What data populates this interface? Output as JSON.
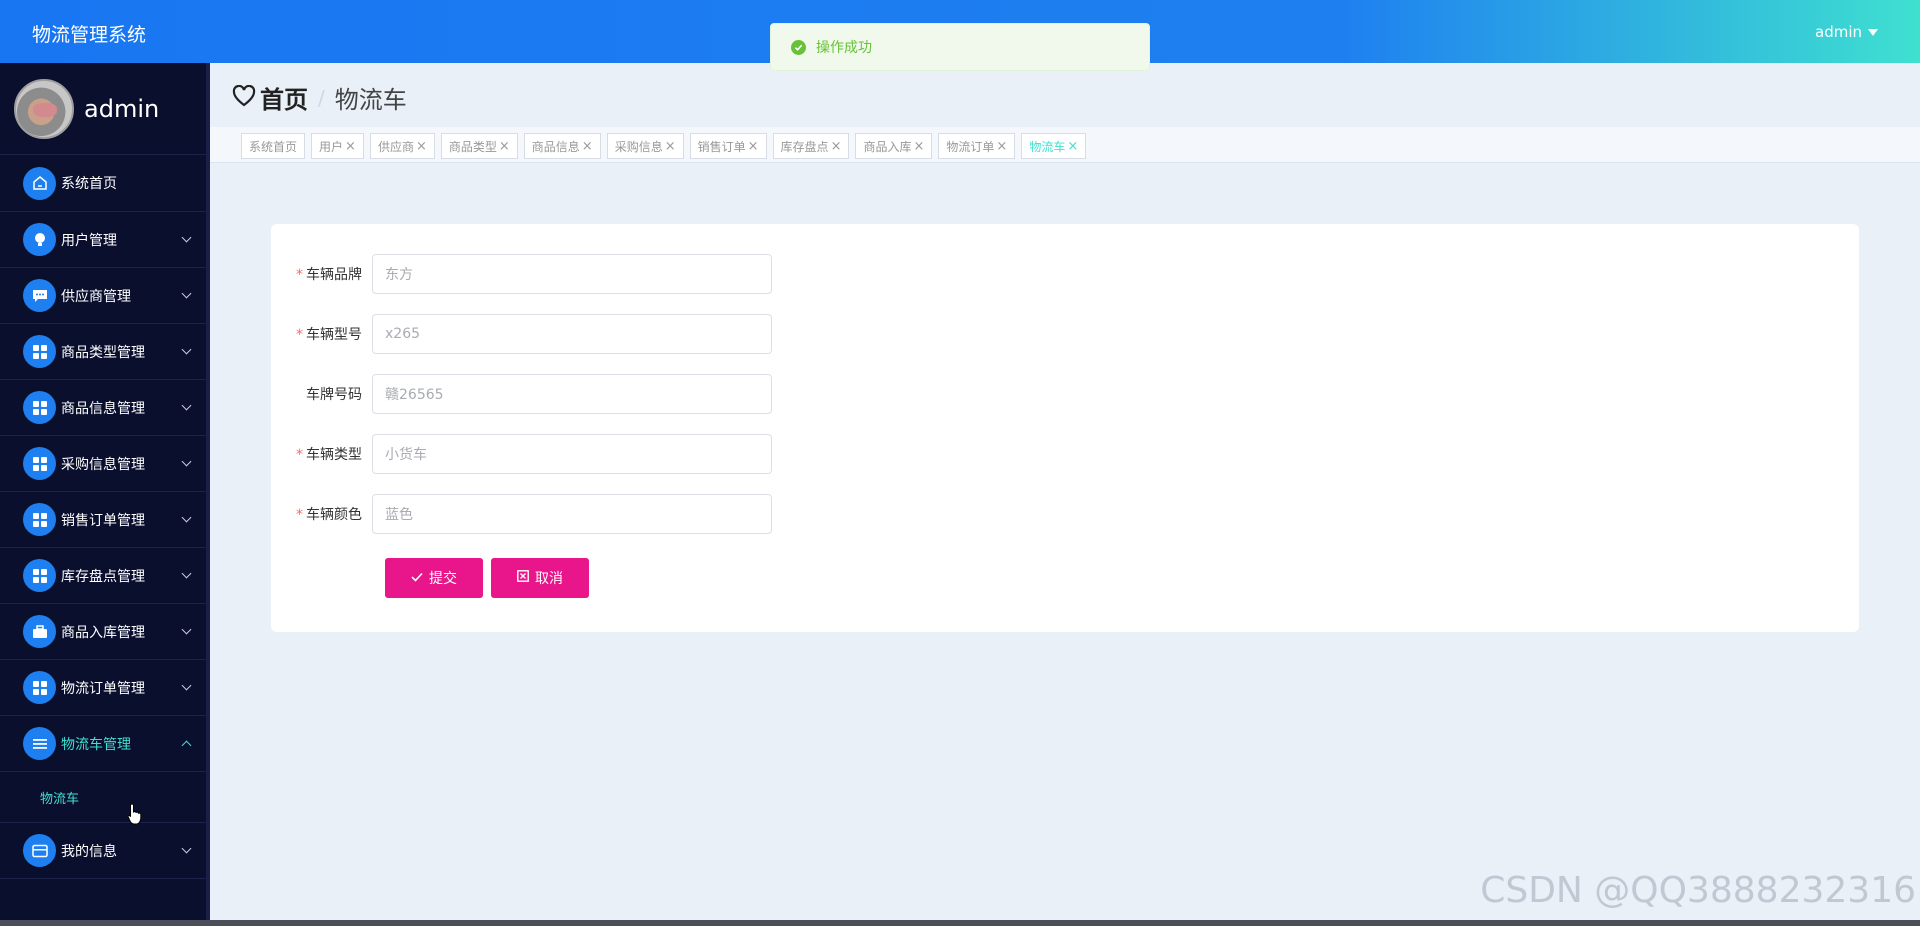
{
  "header": {
    "title": "物流管理系统",
    "user": "admin"
  },
  "toast": {
    "message": "操作成功"
  },
  "sidebar": {
    "username": "admin",
    "items": [
      {
        "label": "系统首页",
        "icon": "home-icon"
      },
      {
        "label": "用户管理",
        "icon": "bulb-icon"
      },
      {
        "label": "供应商管理",
        "icon": "chat-icon"
      },
      {
        "label": "商品类型管理",
        "icon": "grid-icon"
      },
      {
        "label": "商品信息管理",
        "icon": "grid-icon"
      },
      {
        "label": "采购信息管理",
        "icon": "grid-icon"
      },
      {
        "label": "销售订单管理",
        "icon": "grid-icon"
      },
      {
        "label": "库存盘点管理",
        "icon": "grid-icon"
      },
      {
        "label": "商品入库管理",
        "icon": "briefcase-icon"
      },
      {
        "label": "物流订单管理",
        "icon": "grid-icon"
      },
      {
        "label": "物流车管理",
        "icon": "list-icon"
      },
      {
        "label": "我的信息",
        "icon": "wallet-icon"
      }
    ],
    "submenu": {
      "label": "物流车"
    }
  },
  "breadcrumb": {
    "home": "首页",
    "separator": "/",
    "current": "物流车"
  },
  "tags": [
    {
      "label": "系统首页",
      "closable": false
    },
    {
      "label": "用户",
      "closable": true
    },
    {
      "label": "供应商",
      "closable": true
    },
    {
      "label": "商品类型",
      "closable": true
    },
    {
      "label": "商品信息",
      "closable": true
    },
    {
      "label": "采购信息",
      "closable": true
    },
    {
      "label": "销售订单",
      "closable": true
    },
    {
      "label": "库存盘点",
      "closable": true
    },
    {
      "label": "商品入库",
      "closable": true
    },
    {
      "label": "物流订单",
      "closable": true
    },
    {
      "label": "物流车",
      "closable": true,
      "active": true
    }
  ],
  "form": {
    "fields": [
      {
        "label": "车辆品牌",
        "required": true,
        "value": "东方"
      },
      {
        "label": "车辆型号",
        "required": true,
        "value": "x265"
      },
      {
        "label": "车牌号码",
        "required": false,
        "value": "赣26565"
      },
      {
        "label": "车辆类型",
        "required": true,
        "value": "小货车"
      },
      {
        "label": "车辆颜色",
        "required": true,
        "value": "蓝色"
      }
    ],
    "submit_label": "提交",
    "cancel_label": "取消"
  },
  "watermark": "CSDN @QQ3888232316",
  "colors": {
    "header_start": "#1976f2",
    "header_end": "#3fe0d0",
    "sidebar_bg": "#0b0f2e",
    "accent": "#3fe0d0",
    "button": "#e8158b",
    "toast_text": "#67c23a"
  }
}
